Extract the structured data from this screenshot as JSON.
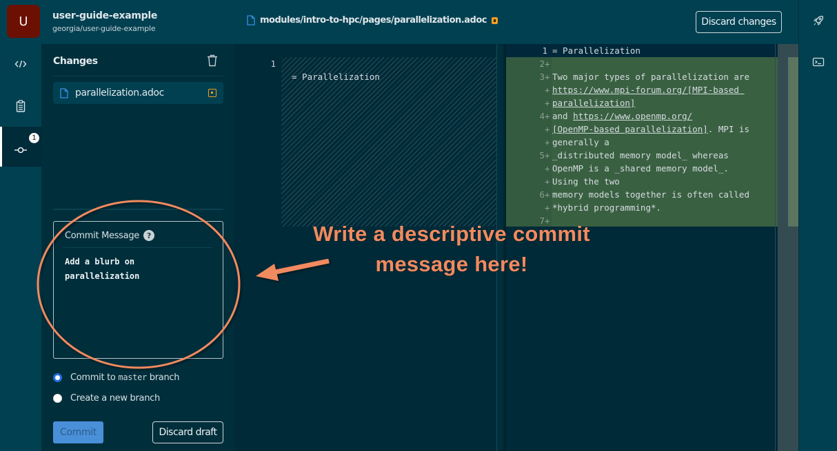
{
  "header": {
    "avatar_letter": "U",
    "repo_title": "user-guide-example",
    "repo_path": "georgia/user-guide-example",
    "file_path": "modules/intro-to-hpc/pages/parallelization.adoc",
    "discard_changes_label": "Discard changes"
  },
  "activity_bar": {
    "items": [
      {
        "name": "code",
        "icon": "code-icon"
      },
      {
        "name": "clipboard",
        "icon": "clipboard-icon"
      },
      {
        "name": "source-control",
        "icon": "git-commit-icon",
        "badge": "1",
        "active": true
      }
    ]
  },
  "right_rail": {
    "items": [
      {
        "name": "deploy",
        "icon": "rocket-icon"
      },
      {
        "name": "terminal",
        "icon": "terminal-icon"
      }
    ]
  },
  "changes_panel": {
    "title": "Changes",
    "files": [
      {
        "name": "parallelization.adoc",
        "status": "modified"
      }
    ],
    "commit_message_label": "Commit Message",
    "help_glyph": "?",
    "commit_message_value": "Add a blurb on\nparallelization",
    "radio_options": [
      {
        "prefix": "Commit to ",
        "code": "master",
        "suffix": " branch",
        "checked": true
      },
      {
        "prefix": "Create a new branch",
        "code": "",
        "suffix": "",
        "checked": false
      }
    ],
    "commit_label": "Commit",
    "discard_draft_label": "Discard draft"
  },
  "diff": {
    "left": {
      "lines": [
        {
          "num": "1",
          "text": "= Parallelization"
        }
      ]
    },
    "right": {
      "lines": [
        {
          "num": "1",
          "marker": "",
          "text": "= Parallelization"
        },
        {
          "num": "2",
          "marker": "+",
          "text": ""
        },
        {
          "num": "3",
          "marker": "+",
          "text": "Two major types of parallelization are"
        },
        {
          "num": "",
          "marker": "+",
          "text": "https://www.mpi-forum.org/[MPI-based ",
          "link": true
        },
        {
          "num": "",
          "marker": "+",
          "text": "parallelization]",
          "link": true
        },
        {
          "num": "4",
          "marker": "+",
          "text": "and ",
          "link_part": "https://www.openmp.org/"
        },
        {
          "num": "",
          "marker": "+",
          "text": "[OpenMP-based parallelization]",
          "link": true,
          "after": ". MPI is"
        },
        {
          "num": "",
          "marker": "+",
          "text": "generally a"
        },
        {
          "num": "5",
          "marker": "+",
          "text": "_distributed memory model_ whereas"
        },
        {
          "num": "",
          "marker": "+",
          "text": "OpenMP is a _shared memory model_."
        },
        {
          "num": "",
          "marker": "+",
          "text": "Using the two"
        },
        {
          "num": "6",
          "marker": "+",
          "text": "memory models together is often called"
        },
        {
          "num": "",
          "marker": "+",
          "text": "*hybrid programming*."
        },
        {
          "num": "7",
          "marker": "+",
          "text": ""
        }
      ]
    }
  },
  "annotation": {
    "line1": "Write a descriptive commit",
    "line2": "message here!",
    "color": "#f28a5f"
  },
  "colors": {
    "header_bg": "#014051",
    "panel_bg": "#002e3b",
    "editor_bg": "#002a38",
    "added_bg": "#3a6042",
    "modified_accent": "#f0a020",
    "primary_button": "#4a90d9",
    "avatar_bg": "#6b1002"
  }
}
